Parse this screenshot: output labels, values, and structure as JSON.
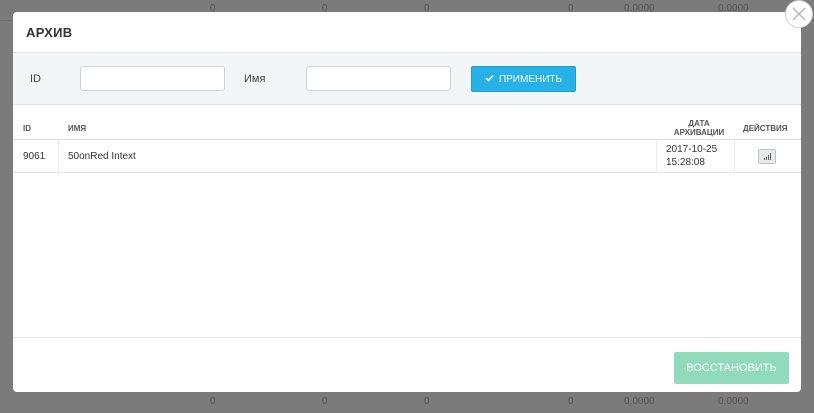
{
  "background": {
    "rows": [
      [
        "0",
        "0",
        "0",
        "0",
        "0.0000",
        "0.0000"
      ],
      [
        "0",
        "0",
        "0",
        "0",
        "0.0000",
        "0.0000"
      ]
    ]
  },
  "modal": {
    "title": "АРХИВ",
    "filters": {
      "id_label": "ID",
      "id_value": "",
      "name_label": "Имя",
      "name_value": "",
      "apply_label": "ПРИМЕНИТЬ"
    },
    "table": {
      "headers": {
        "id": "ID",
        "name": "ИМЯ",
        "archived_line1": "ДАТА",
        "archived_line2": "АРХИВАЦИИ",
        "actions": "ДЕЙСТВИЯ"
      },
      "rows": [
        {
          "id": "9061",
          "name": "50onRed Intext",
          "date": "2017-10-25",
          "time": "15:28:08"
        }
      ]
    },
    "restore_label": "ВОССТАНОВИТЬ"
  },
  "colors": {
    "accent": "#27b1e6",
    "restore": "#8fdbbc"
  }
}
